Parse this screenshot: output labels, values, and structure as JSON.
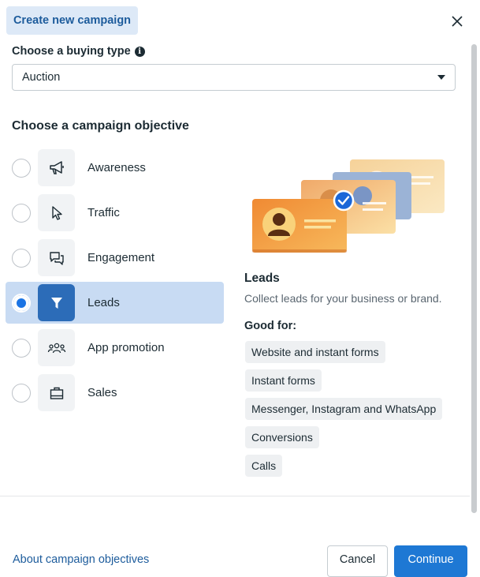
{
  "header": {
    "tab_label": "Create new campaign",
    "close_icon": "close-icon"
  },
  "buying_type": {
    "label": "Choose a buying type",
    "info_icon": "i",
    "selected": "Auction"
  },
  "objective": {
    "title": "Choose a campaign objective",
    "items": [
      {
        "label": "Awareness",
        "icon": "megaphone-icon",
        "selected": false
      },
      {
        "label": "Traffic",
        "icon": "cursor-icon",
        "selected": false
      },
      {
        "label": "Engagement",
        "icon": "chat-bubbles-icon",
        "selected": false
      },
      {
        "label": "Leads",
        "icon": "filter-icon",
        "selected": true
      },
      {
        "label": "App promotion",
        "icon": "people-icon",
        "selected": false
      },
      {
        "label": "Sales",
        "icon": "shopping-bag-icon",
        "selected": false
      }
    ]
  },
  "detail": {
    "title": "Leads",
    "description": "Collect leads for your business or brand.",
    "good_for_label": "Good for:",
    "chips": [
      "Website and instant forms",
      "Instant forms",
      "Messenger, Instagram and WhatsApp",
      "Conversions",
      "Calls"
    ]
  },
  "footer": {
    "about_link": "About campaign objectives",
    "cancel_label": "Cancel",
    "continue_label": "Continue"
  },
  "colors": {
    "accent": "#1e78d4",
    "selected_row": "#c8dbf3",
    "tab_bg": "#dde9f7",
    "link": "#1d5c9c"
  }
}
